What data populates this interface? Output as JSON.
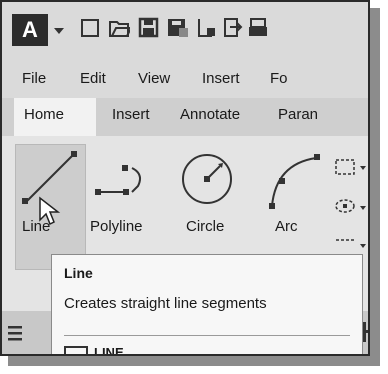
{
  "app_button": {
    "letter": "A"
  },
  "quick_access": {
    "icons": [
      "new-file-icon",
      "open-folder-icon",
      "save-icon",
      "save-as-icon",
      "export-icon",
      "import-icon",
      "print-icon"
    ]
  },
  "menubar": {
    "items": [
      "File",
      "Edit",
      "View",
      "Insert",
      "Fo"
    ]
  },
  "ribbon_tabs": {
    "items": [
      "Home",
      "Insert",
      "Annotate",
      "Paran"
    ],
    "active": "Home"
  },
  "draw_tools": {
    "line": "Line",
    "polyline": "Polyline",
    "circle": "Circle",
    "arc": "Arc"
  },
  "tooltip": {
    "title": "Line",
    "description": "Creates straight line segments",
    "command": "LINE"
  },
  "colors": {
    "app_button_bg": "#2c2c2c",
    "active_tab_bg": "#f2f2f2",
    "tooltip_bg": "#f7f7f7"
  }
}
